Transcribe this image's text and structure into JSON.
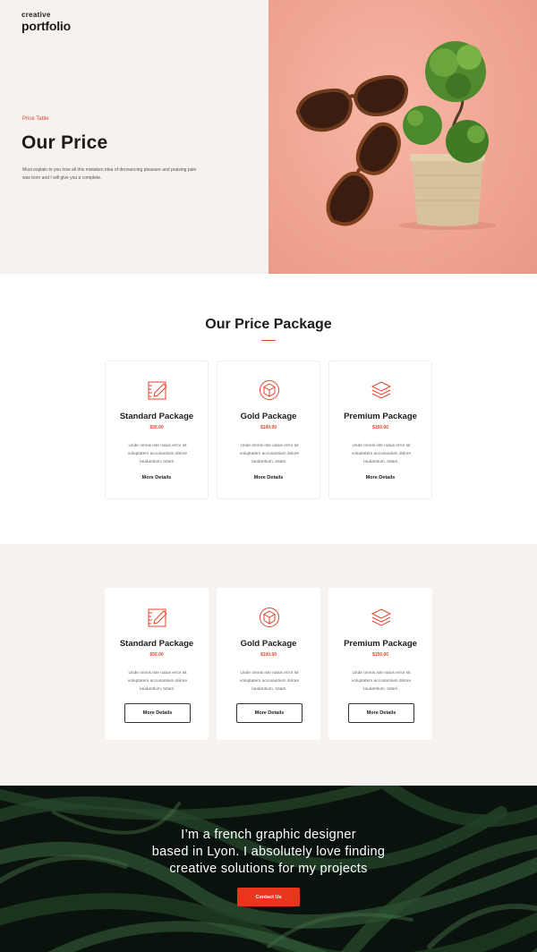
{
  "brand": {
    "line1": "creative",
    "line2": "portfolio"
  },
  "hero": {
    "eyebrow": "Price Table",
    "title": "Our Price",
    "text": "Must explain to you how all this mistaken idea of denouncing pleasure and praising pain was born and I will give you a complete."
  },
  "packages_section": {
    "title": "Our Price Package",
    "cards": [
      {
        "icon": "pencil-ruler-icon",
        "name": "Standard Package",
        "price": "$50.00",
        "desc": "Unde omnis iste natus error sit voluptatem accusantium dolore laudantium, totam.",
        "link": "More Details"
      },
      {
        "icon": "cube-icon",
        "name": "Gold Package",
        "price": "$100.00",
        "desc": "Unde omnis iste natus error sit voluptatem accusantium dolore laudantium, totam.",
        "link": "More Details"
      },
      {
        "icon": "layers-icon",
        "name": "Premium Package",
        "price": "$150.00",
        "desc": "Unde omnis iste natus error sit voluptatem accusantium dolore laudantium, totam.",
        "link": "More Details"
      }
    ]
  },
  "packages_alt": {
    "cards": [
      {
        "icon": "pencil-ruler-icon",
        "name": "Standard Package",
        "price": "$50.00",
        "desc": "Unde omnis iste natus error sit voluptatem accusantium dolore laudantium, totam.",
        "button": "More Details"
      },
      {
        "icon": "cube-icon",
        "name": "Gold Package",
        "price": "$100.00",
        "desc": "Unde omnis iste natus error sit voluptatem accusantium dolore laudantium, totam.",
        "button": "More Details"
      },
      {
        "icon": "layers-icon",
        "name": "Premium Package",
        "price": "$150.00",
        "desc": "Unde omnis iste natus error sit voluptatem accusantium dolore laudantium, totam.",
        "button": "More Details"
      }
    ]
  },
  "cta": {
    "line1": "I’m a french graphic designer",
    "line2": "based in Lyon. I absolutely love finding",
    "line3": "creative solutions for my projects",
    "button": "Contact Us"
  },
  "colors": {
    "accent": "#e0452b",
    "hero_bg": "#f6f2ef",
    "hero_image_bg": "#f1a593",
    "cta_button": "#e8361c"
  }
}
